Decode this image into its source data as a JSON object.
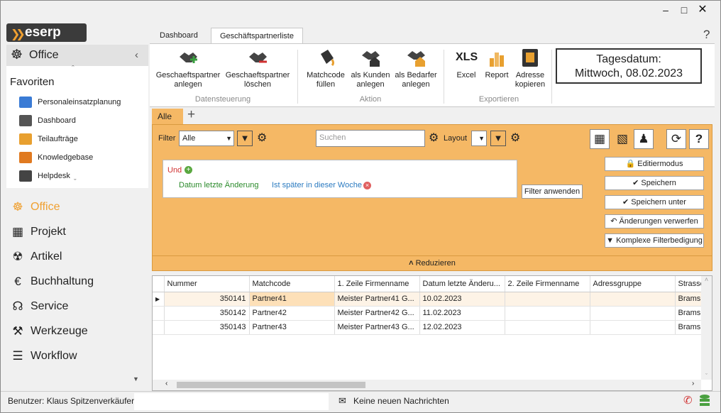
{
  "window": {
    "help": "?"
  },
  "app": {
    "logo": "eserp"
  },
  "sidebar": {
    "office_header": "Office",
    "favorites_title": "Favoriten",
    "favorites": [
      {
        "label": "Personaleinsatzplanung",
        "icon": "person-card-icon",
        "color": "#3a7bd5"
      },
      {
        "label": "Dashboard",
        "icon": "gauge-icon",
        "color": "#555555"
      },
      {
        "label": "Teilaufträge",
        "icon": "stack-icon",
        "color": "#e8a030"
      },
      {
        "label": "Knowledgebase",
        "icon": "info-book-icon",
        "color": "#e07a20"
      },
      {
        "label": "Helpdesk",
        "icon": "lifebuoy-icon",
        "color": "#444444"
      }
    ],
    "nav": [
      {
        "label": "Office",
        "icon": "helm-icon",
        "active": true
      },
      {
        "label": "Projekt",
        "icon": "gantt-icon"
      },
      {
        "label": "Artikel",
        "icon": "siren-icon"
      },
      {
        "label": "Buchhaltung",
        "icon": "euro-icon"
      },
      {
        "label": "Service",
        "icon": "headset-icon"
      },
      {
        "label": "Werkzeuge",
        "icon": "tools-icon"
      },
      {
        "label": "Workflow",
        "icon": "workflow-icon"
      }
    ],
    "accent": "#f0a030"
  },
  "ribbon": {
    "tabs": [
      {
        "label": "Dashboard"
      },
      {
        "label": "Geschäftspartnerliste",
        "active": true
      }
    ],
    "groups": [
      {
        "label": "Datensteuerung",
        "buttons": [
          {
            "label1": "Geschaeftspartner",
            "label2": "anlegen"
          },
          {
            "label1": "Geschaeftspartner",
            "label2": "löschen"
          }
        ]
      },
      {
        "label": "Aktion",
        "buttons": [
          {
            "label1": "Matchcode",
            "label2": "füllen"
          },
          {
            "label1": "als Kunden",
            "label2": "anlegen"
          },
          {
            "label1": "als Bedarfer",
            "label2": "anlegen"
          }
        ]
      },
      {
        "label": "Exportieren",
        "buttons": [
          {
            "label1": "Excel",
            "label2": "",
            "glyph": "XLS"
          },
          {
            "label1": "Report",
            "label2": ""
          },
          {
            "label1": "Adresse",
            "label2": "kopieren"
          }
        ]
      }
    ],
    "date_title": "Tagesdatum:",
    "date_value": "Mittwoch, 08.02.2023"
  },
  "content": {
    "tab_all": "Alle",
    "add_tab": "+",
    "filter_label": "Filter",
    "filter_value": "Alle",
    "search_placeholder": "Suchen",
    "layout_label": "Layout",
    "filter_expr": {
      "op": "Und",
      "field": "Datum letzte Änderung",
      "cond": "Ist später in dieser Woche"
    },
    "apply_filter": "Filter anwenden",
    "side_buttons": [
      "Editiermodus",
      "Speichern",
      "Speichern unter",
      "Änderungen verwerfen",
      "Komplexe Filterbedigung"
    ],
    "reduce": "Reduzieren"
  },
  "grid": {
    "columns": [
      "Nummer",
      "Matchcode",
      "1. Zeile Firmenname",
      "Datum letzte Änderu...",
      "2. Zeile Firmenname",
      "Adressgruppe",
      "Strasse"
    ],
    "rows": [
      [
        "350141",
        "Partner41",
        "Meister Partner41 G...",
        "10.02.2023",
        "",
        "",
        "Brams"
      ],
      [
        "350142",
        "Partner42",
        "Meister Partner42 G...",
        "11.02.2023",
        "",
        "",
        "Brams"
      ],
      [
        "350143",
        "Partner43",
        "Meister Partner43 G...",
        "12.02.2023",
        "",
        "",
        "Brams"
      ]
    ]
  },
  "status": {
    "user": "Benutzer: Klaus Spitzenverkäufer",
    "messages": "Keine neuen Nachrichten"
  }
}
